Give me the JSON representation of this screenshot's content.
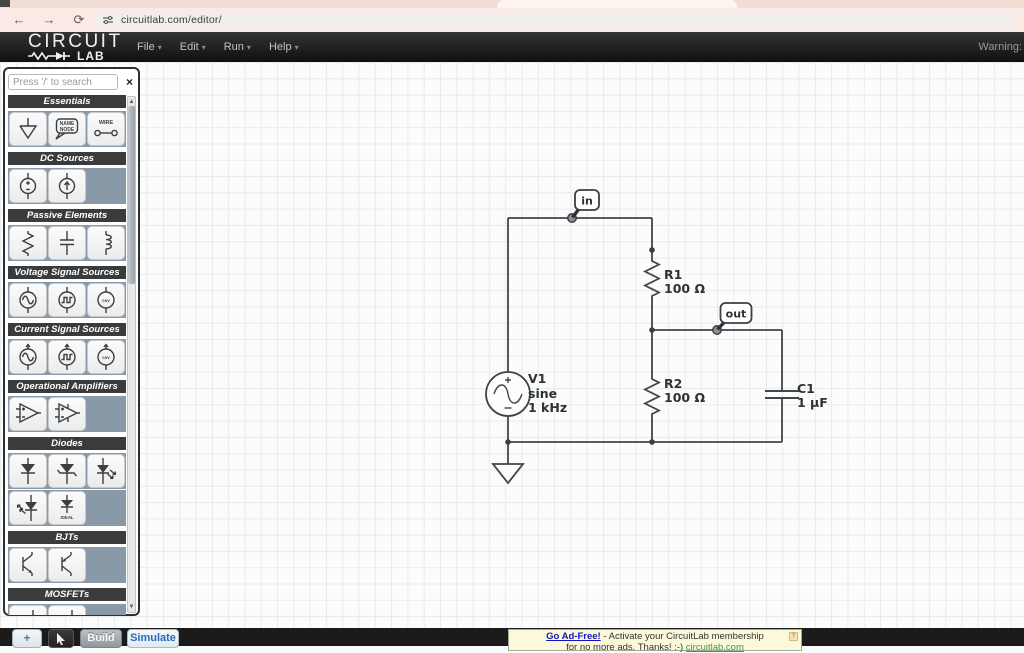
{
  "browser": {
    "url": "circuitlab.com/editor/",
    "icons": {
      "back": "←",
      "forward": "→",
      "reload": "⟳"
    }
  },
  "header": {
    "logo_top": "CIRCUIT",
    "logo_bottom": "LAB",
    "menu_caret": "▾",
    "menus": [
      {
        "label": "File"
      },
      {
        "label": "Edit"
      },
      {
        "label": "Run"
      },
      {
        "label": "Help"
      }
    ],
    "warning": "Warning:"
  },
  "sidebar": {
    "search_placeholder": "Press '/' to search",
    "close_label": "×",
    "scroll_up": "▲",
    "scroll_down": "▼",
    "sections": [
      {
        "label": "Essentials",
        "items": [
          "ground",
          "name-node",
          "wire"
        ]
      },
      {
        "label": "DC Sources",
        "items": [
          "dc-voltage-source",
          "dc-current-source"
        ]
      },
      {
        "label": "Passive Elements",
        "items": [
          "resistor",
          "capacitor",
          "inductor"
        ]
      },
      {
        "label": "Voltage Signal Sources",
        "items": [
          "sine-voltage-source",
          "pulse-voltage-source",
          "csv-voltage-source"
        ]
      },
      {
        "label": "Current Signal Sources",
        "items": [
          "sine-current-source",
          "pulse-current-source",
          "csv-current-source"
        ]
      },
      {
        "label": "Operational Amplifiers",
        "items": [
          "op-amp",
          "op-amp-power"
        ]
      },
      {
        "label": "Diodes",
        "items": [
          "diode",
          "zener-diode",
          "led",
          "photodiode",
          "ideal-diode"
        ]
      },
      {
        "label": "BJTs",
        "items": [
          "npn-transistor",
          "pnp-transistor"
        ]
      },
      {
        "label": "MOSFETs",
        "items": [
          "nmos-transistor",
          "pmos-transistor"
        ]
      }
    ],
    "tile_texts": {
      "name_line1": "NAME",
      "name_line2": "NODE",
      "wire": "WIRE",
      "csv": "csv",
      "ideal": "IDEAL"
    }
  },
  "circuit": {
    "components": {
      "v1": {
        "name": "V1",
        "type": "sine",
        "freq": "1 kHz"
      },
      "r1": {
        "name": "R1",
        "value": "100 Ω"
      },
      "r2": {
        "name": "R2",
        "value": "100 Ω"
      },
      "c1": {
        "name": "C1",
        "value": "1 µF"
      }
    },
    "nodes": {
      "in": "in",
      "out": "out"
    }
  },
  "bottombar": {
    "plus_label": "+",
    "build_label": "Build",
    "simulate_label": "Simulate",
    "ad": {
      "link1": "Go Ad-Free!",
      "text1": " - Activate your CircuitLab membership",
      "text2": "for no more ads. Thanks! :-) ",
      "link2": "circuitlab.com",
      "help": "?"
    }
  }
}
